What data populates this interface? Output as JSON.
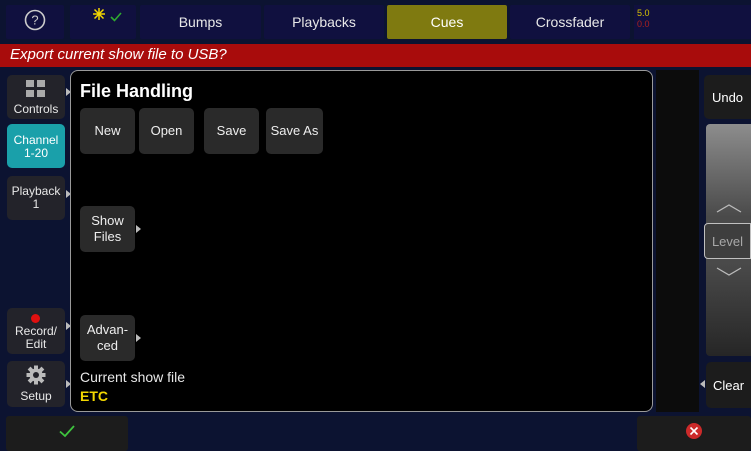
{
  "header": {
    "help_icon": "question-circle-icon",
    "tabs": [
      {
        "label": "Bumps",
        "active": false
      },
      {
        "label": "Playbacks",
        "active": false
      },
      {
        "label": "Cues",
        "active": true
      },
      {
        "label": "Crossfader",
        "active": false
      }
    ],
    "level_top": "5.0",
    "level_bottom": "0.0"
  },
  "banner": {
    "text": "Export current show file to USB?"
  },
  "sidebar": {
    "controls_label": "Controls",
    "channel_label": "Channel\n1-20",
    "playback_label": "Playback\n1",
    "record_label": "Record/\nEdit",
    "setup_label": "Setup"
  },
  "panel": {
    "title": "File Handling",
    "buttons": {
      "new": "New",
      "open": "Open",
      "save": "Save",
      "save_as": "Save As"
    },
    "show_files_label": "Show\nFiles",
    "advanced_label": "Advan-\nced",
    "current_label": "Current show file",
    "current_value": "ETC"
  },
  "right": {
    "undo_label": "Undo",
    "level_label": "Level",
    "clear_label": "Clear"
  },
  "colors": {
    "accent_yellow": "#f2d600",
    "banner_red": "#a80c0c",
    "active_tab": "#7f7a10",
    "channel_cyan": "#1aa0aa",
    "confirm_green": "#3ec43e",
    "cancel_red": "#cc2a2a"
  }
}
